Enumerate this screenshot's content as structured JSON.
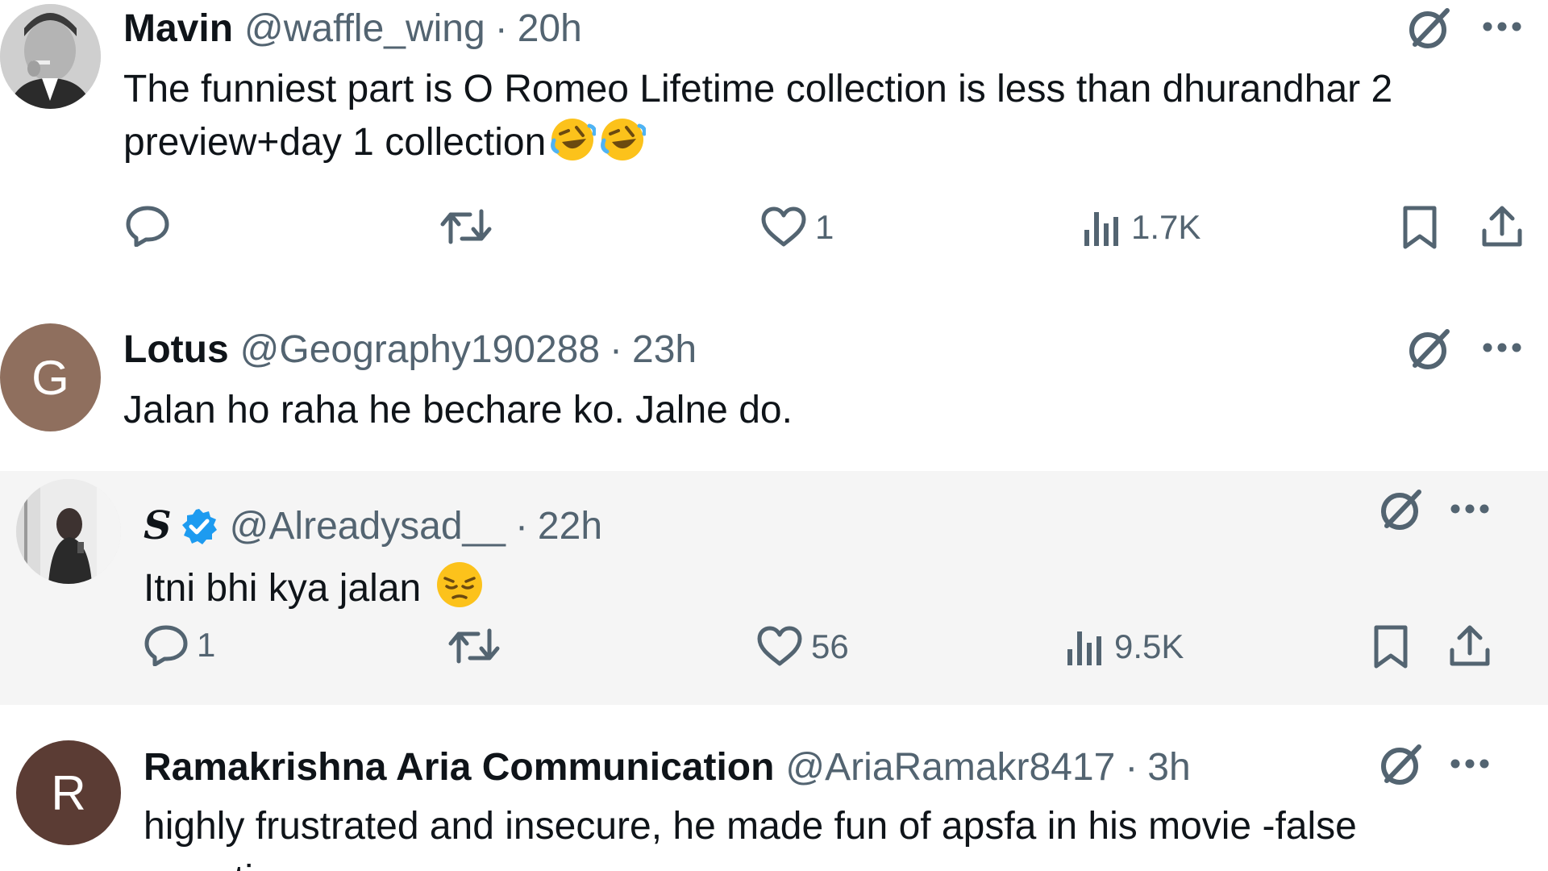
{
  "tweets": [
    {
      "name": "Mavin",
      "handle": "@waffle_wing",
      "separator": "·",
      "time": "20h",
      "line1": "The funniest part is O Romeo Lifetime collection is less than dhurandhar 2",
      "line2": "preview+day 1 collection",
      "avatar_icon": "man-smoking-photo",
      "emoji": [
        "rolling-laughing-emoji",
        "rolling-laughing-emoji"
      ],
      "stats": {
        "replies": "",
        "reposts": "",
        "likes": "1",
        "views": "1.7K"
      }
    },
    {
      "name": "Lotus",
      "handle": "@Geography190288",
      "separator": "·",
      "time": "23h",
      "line1": "Jalan ho raha he bechare ko. Jalne do.",
      "avatar_letter": "G",
      "avatar_color": "#8f6f5e"
    },
    {
      "name": "S",
      "handle": "@Alreadysad__",
      "separator": "·",
      "time": "22h",
      "verified": true,
      "line1": "Itni bhi kya jalan",
      "avatar_icon": "woman-selfie-photo",
      "emoji": [
        "pensive-face-emoji"
      ],
      "stats": {
        "replies": "1",
        "reposts": "",
        "likes": "56",
        "views": "9.5K"
      }
    },
    {
      "name": "Ramakrishna Aria Communication",
      "handle": "@AriaRamakr8417",
      "separator": "·",
      "time": "3h",
      "line1": "highly frustrated and insecure, he made fun of apsfa  in his movie -false",
      "line2": "narrative",
      "avatar_letter": "R",
      "avatar_color": "#5b3c34"
    }
  ],
  "colors": {
    "text": "#0f1419",
    "secondary": "#536471",
    "verified_blue": "#1d9bf0",
    "reply_background": "#f5f5f5"
  }
}
